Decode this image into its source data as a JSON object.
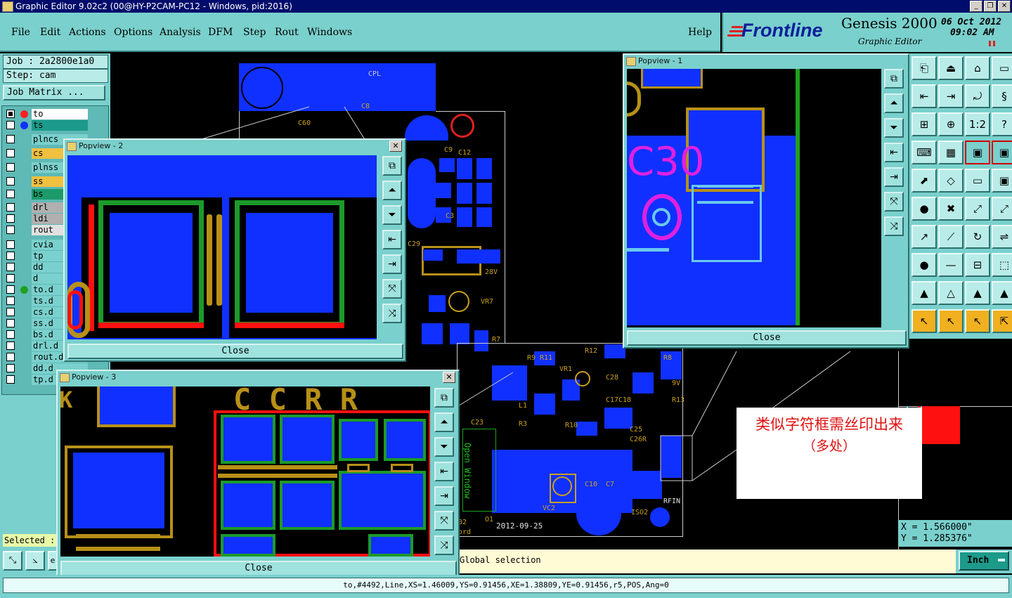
{
  "window": {
    "title": "Graphic Editor 9.02c2 (00@HY-P2CAM-PC12 - Windows, pid:2016)"
  },
  "menu": {
    "items": [
      "File",
      "Edit",
      "Actions",
      "Options",
      "Analysis",
      "DFM",
      "Step",
      "Rout",
      "Windows"
    ],
    "help": "Help"
  },
  "brand": {
    "logo": "Frontline",
    "product": "Genesis 2000",
    "subtitle": "Graphic Editor",
    "date": "06 Oct 2012",
    "time": "09:02 AM"
  },
  "job": {
    "job_label": "Job : 2a2800e1a0",
    "step_label": "Step: cam",
    "matrix_button": "Job Matrix ..."
  },
  "layers": [
    {
      "name": "to",
      "color": "#ff2020",
      "selected": true
    },
    {
      "name": "ts",
      "color": "#1030ff",
      "selected": false
    },
    {
      "name": "plncs",
      "color": "",
      "selected": false
    },
    {
      "name": "cs",
      "color": "",
      "selected": false
    },
    {
      "name": "plnss",
      "color": "",
      "selected": false
    },
    {
      "name": "ss",
      "color": "",
      "selected": false
    },
    {
      "name": "bs",
      "color": "",
      "selected": false
    },
    {
      "name": "drl",
      "color": "",
      "selected": false
    },
    {
      "name": "ldi",
      "color": "",
      "selected": false
    },
    {
      "name": "rout",
      "color": "",
      "selected": false
    },
    {
      "name": "cvia",
      "color": "",
      "selected": false
    },
    {
      "name": "tp",
      "color": "",
      "selected": false
    },
    {
      "name": "dd",
      "color": "",
      "selected": false
    },
    {
      "name": "d",
      "color": "",
      "selected": false
    },
    {
      "name": "to.d",
      "color": "#20a020",
      "selected": false
    },
    {
      "name": "ts.d",
      "color": "",
      "selected": false
    },
    {
      "name": "cs.d",
      "color": "",
      "selected": false
    },
    {
      "name": "ss.d",
      "color": "",
      "selected": false
    },
    {
      "name": "bs.d",
      "color": "",
      "selected": false
    },
    {
      "name": "drl.d",
      "color": "",
      "selected": false
    },
    {
      "name": "rout.d",
      "color": "",
      "selected": false
    },
    {
      "name": "dd.d",
      "color": "",
      "selected": false
    },
    {
      "name": "tp.d",
      "color": "",
      "selected": false
    }
  ],
  "selected_label": "Selected :",
  "popviews": [
    {
      "title": "Popview - 1",
      "close_label": "Close"
    },
    {
      "title": "Popview - 2",
      "close_label": "Close"
    },
    {
      "title": "Popview - 3",
      "close_label": "Close"
    }
  ],
  "board": {
    "silk_labels": [
      "CPL",
      "C60",
      "C8",
      "C12",
      "C9",
      "C3",
      "C29",
      "28V",
      "VR7",
      "R7",
      "R12",
      "R8",
      "VR1",
      "C28",
      "C17",
      "C18",
      "C25",
      "C26R",
      "R10",
      "C23",
      "R3",
      "L1",
      "C10",
      "C7",
      "VC2",
      "ISO2",
      "RFIN",
      "2012-09-25",
      "ord",
      "02",
      "O1",
      "9V",
      "R13",
      "Open Window",
      "R9",
      "R11"
    ]
  },
  "annotation": {
    "line1": "类似字符框需丝印出来",
    "line2": "（多处）"
  },
  "coords": {
    "x": "X  =  1.566000\"",
    "y": "Y  =  1.285376\""
  },
  "prompt_text": "Global selection",
  "units": "Inch",
  "status_line": "to,#4492,Line,XS=1.46009,YS=0.91456,XE=1.38809,YE=0.91456,r5,POS,Ang=0"
}
